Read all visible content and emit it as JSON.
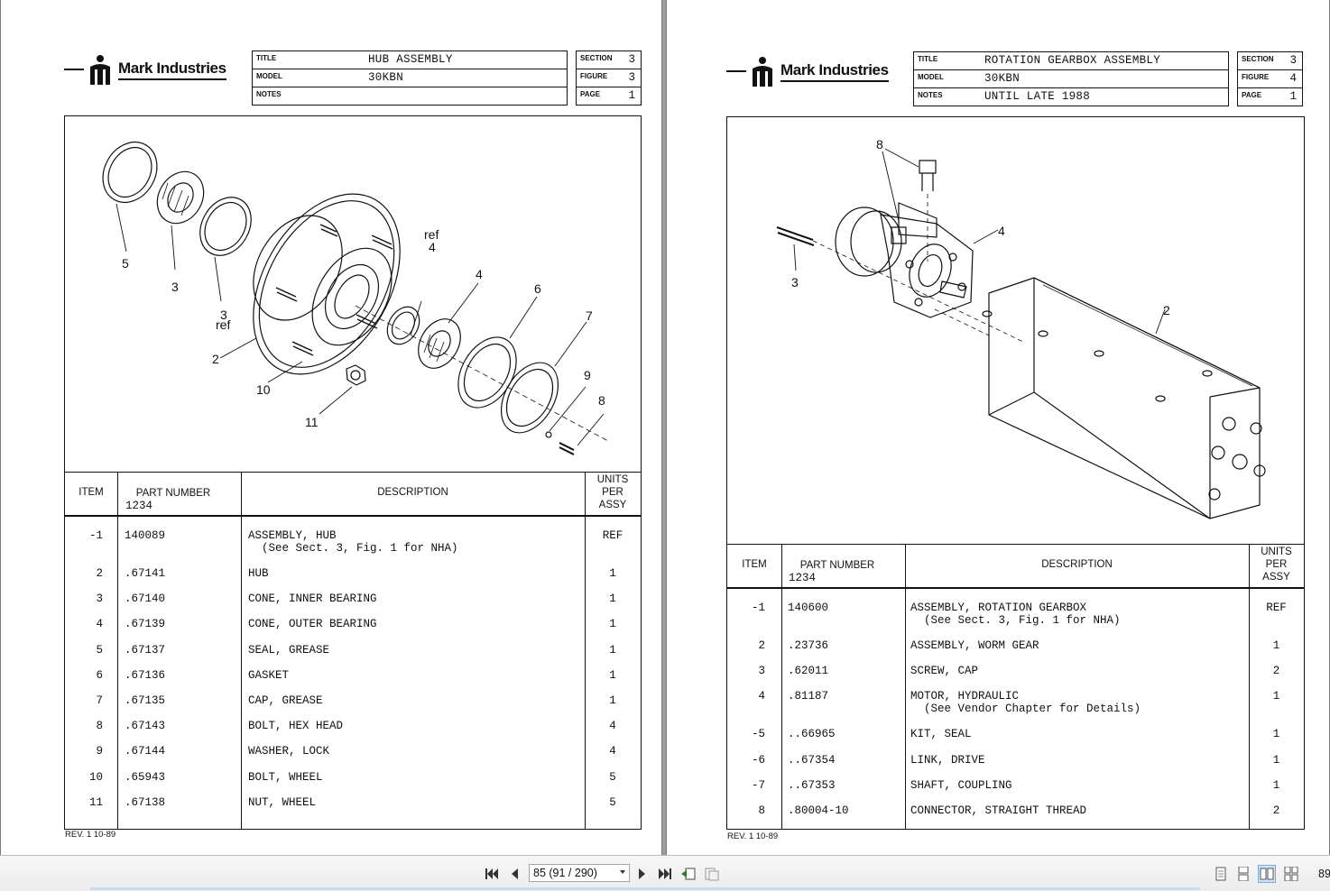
{
  "brand": "Mark Industries",
  "title_labels": {
    "title": "TITLE",
    "model": "MODEL",
    "notes": "NOTES",
    "section": "SECTION",
    "figure": "FIGURE",
    "page": "PAGE"
  },
  "table_headers": {
    "item": "ITEM",
    "part_number": "PART NUMBER",
    "part_code": "1234",
    "description": "DESCRIPTION",
    "units1": "UNITS",
    "units2": "PER",
    "units3": "ASSY"
  },
  "left_page": {
    "title": "HUB ASSEMBLY",
    "model": "30KBN",
    "notes": "",
    "section": "3",
    "figure": "3",
    "page": "1",
    "callouts": [
      "5",
      "3",
      "3",
      "ref",
      "2",
      "10",
      "11",
      "ref",
      "4",
      "4",
      "6",
      "7",
      "9",
      "8"
    ],
    "rows": [
      {
        "item": "-1",
        "part": "140089",
        "desc": "ASSEMBLY, HUB",
        "desc2": "  (See Sect. 3, Fig. 1 for NHA)",
        "qty": "REF"
      },
      {
        "item": "2",
        "part": ".67141",
        "desc": "HUB",
        "desc2": "",
        "qty": "1"
      },
      {
        "item": "3",
        "part": ".67140",
        "desc": "CONE, INNER BEARING",
        "desc2": "",
        "qty": "1"
      },
      {
        "item": "4",
        "part": ".67139",
        "desc": "CONE, OUTER BEARING",
        "desc2": "",
        "qty": "1"
      },
      {
        "item": "5",
        "part": ".67137",
        "desc": "SEAL, GREASE",
        "desc2": "",
        "qty": "1"
      },
      {
        "item": "6",
        "part": ".67136",
        "desc": "GASKET",
        "desc2": "",
        "qty": "1"
      },
      {
        "item": "7",
        "part": ".67135",
        "desc": "CAP, GREASE",
        "desc2": "",
        "qty": "1"
      },
      {
        "item": "8",
        "part": ".67143",
        "desc": "BOLT, HEX HEAD",
        "desc2": "",
        "qty": "4"
      },
      {
        "item": "9",
        "part": ".67144",
        "desc": "WASHER, LOCK",
        "desc2": "",
        "qty": "4"
      },
      {
        "item": "10",
        "part": ".65943",
        "desc": "BOLT, WHEEL",
        "desc2": "",
        "qty": "5"
      },
      {
        "item": "11",
        "part": ".67138",
        "desc": "NUT, WHEEL",
        "desc2": "",
        "qty": "5"
      }
    ],
    "rev": "REV. 1  10-89"
  },
  "right_page": {
    "title": "ROTATION GEARBOX ASSEMBLY",
    "model": "30KBN",
    "notes": "UNTIL LATE 1988",
    "section": "3",
    "figure": "4",
    "page": "1",
    "callouts": [
      "8",
      "4",
      "3",
      "2"
    ],
    "rows": [
      {
        "item": "-1",
        "part": "140600",
        "desc": "ASSEMBLY, ROTATION GEARBOX",
        "desc2": "  (See Sect. 3, Fig. 1 for NHA)",
        "qty": "REF"
      },
      {
        "item": "2",
        "part": ".23736",
        "desc": "ASSEMBLY, WORM GEAR",
        "desc2": "",
        "qty": "1"
      },
      {
        "item": "3",
        "part": ".62011",
        "desc": "SCREW, CAP",
        "desc2": "",
        "qty": "2"
      },
      {
        "item": "4",
        "part": ".81187",
        "desc": "MOTOR, HYDRAULIC",
        "desc2": "  (See Vendor Chapter for Details)",
        "qty": "1"
      },
      {
        "item": "-5",
        "part": "..66965",
        "desc": "KIT, SEAL",
        "desc2": "",
        "qty": "1"
      },
      {
        "item": "-6",
        "part": "..67354",
        "desc": "LINK, DRIVE",
        "desc2": "",
        "qty": "1"
      },
      {
        "item": "-7",
        "part": "..67353",
        "desc": "SHAFT, COUPLING",
        "desc2": "",
        "qty": "1"
      },
      {
        "item": "8",
        "part": ".80004-10",
        "desc": "CONNECTOR, STRAIGHT THREAD",
        "desc2": "",
        "qty": "2"
      }
    ],
    "rev": "REV. 1  10-89"
  },
  "toolbar": {
    "page_indicator": "85 (91 / 290)",
    "zoom": "89",
    "icons": [
      "first-page-icon",
      "prev-page-icon",
      "next-page-icon",
      "last-page-icon",
      "previous-view-icon",
      "next-view-icon",
      "single-page-icon",
      "continuous-icon",
      "facing-icon",
      "continuous-facing-icon"
    ]
  }
}
